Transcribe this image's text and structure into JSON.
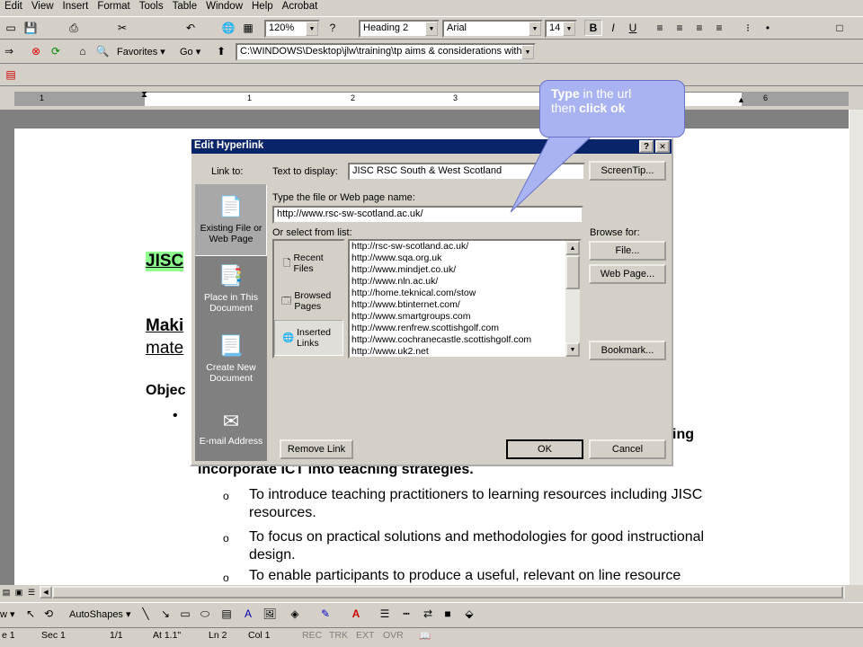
{
  "menu": [
    "Edit",
    "View",
    "Insert",
    "Format",
    "Tools",
    "Table",
    "Window",
    "Help",
    "Acrobat"
  ],
  "toolbar": {
    "zoom": "120%",
    "style": "Heading 2",
    "font": "Arial",
    "size": "14",
    "bold": "B",
    "italic": "I",
    "underline": "U"
  },
  "web": {
    "favorites": "Favorites",
    "go": "Go",
    "address": "C:\\WINDOWS\\Desktop\\jlw\\training\\tp aims & considerations with"
  },
  "ruler": {
    "marks": [
      "1",
      "1",
      "2",
      "3",
      "5",
      "6"
    ]
  },
  "document": {
    "heading1": "JISC",
    "heading2a": "Maki",
    "heading2b": "mate",
    "objectives": "Objec",
    "bullet_end": "ing",
    "line_incorporate": "Incorporate ICT into teaching strategies.",
    "subbullets": [
      "To introduce teaching practitioners to learning resources including JISC resources.",
      "To focus on practical solutions and methodologies for good instructional design.",
      "To enable participants to produce a useful, relevant on line resource"
    ]
  },
  "dialog": {
    "title": "Edit Hyperlink",
    "help": "?",
    "close": "✕",
    "link_to": "Link to:",
    "link_targets": [
      "Existing File or Web Page",
      "Place in This Document",
      "Create New Document",
      "E-mail Address"
    ],
    "text_to_display_label": "Text to display:",
    "text_to_display": "JISC RSC South & West Scotland",
    "screentip": "ScreenTip...",
    "file_label": "Type the file or Web page name:",
    "file_value": "http://www.rsc-sw-scotland.ac.uk/",
    "select_label": "Or select from list:",
    "browse_for": "Browse for:",
    "sources": [
      "Recent Files",
      "Browsed Pages",
      "Inserted Links"
    ],
    "urls": [
      "http://rsc-sw-scotland.ac.uk/",
      "http://www.sqa.org.uk",
      "http://www.mindjet.co.uk/",
      "http://www.nln.ac.uk/",
      "http://home.teknical.com/stow",
      "http://www.btinternet.com/",
      "http://www.smartgroups.com",
      "http://www.renfrew.scottishgolf.com",
      "http://www.cochranecastle.scottishgolf.com",
      "http://www.uk2.net"
    ],
    "file_btn": "File...",
    "webpage_btn": "Web Page...",
    "bookmark_btn": "Bookmark...",
    "remove_btn": "Remove Link",
    "ok_btn": "OK",
    "cancel_btn": "Cancel"
  },
  "callout": {
    "line1_bold": "Type",
    "line1": " in the url",
    "line2": "then ",
    "line2_bold": "click ok"
  },
  "drawing": {
    "autoshapes": "AutoShapes"
  },
  "status": {
    "page": "e 1",
    "sec": "Sec 1",
    "pages": "1/1",
    "at": "At 1.1\"",
    "ln": "Ln 2",
    "col": "Col 1",
    "rec": "REC",
    "trk": "TRK",
    "ext": "EXT",
    "ovr": "OVR"
  }
}
